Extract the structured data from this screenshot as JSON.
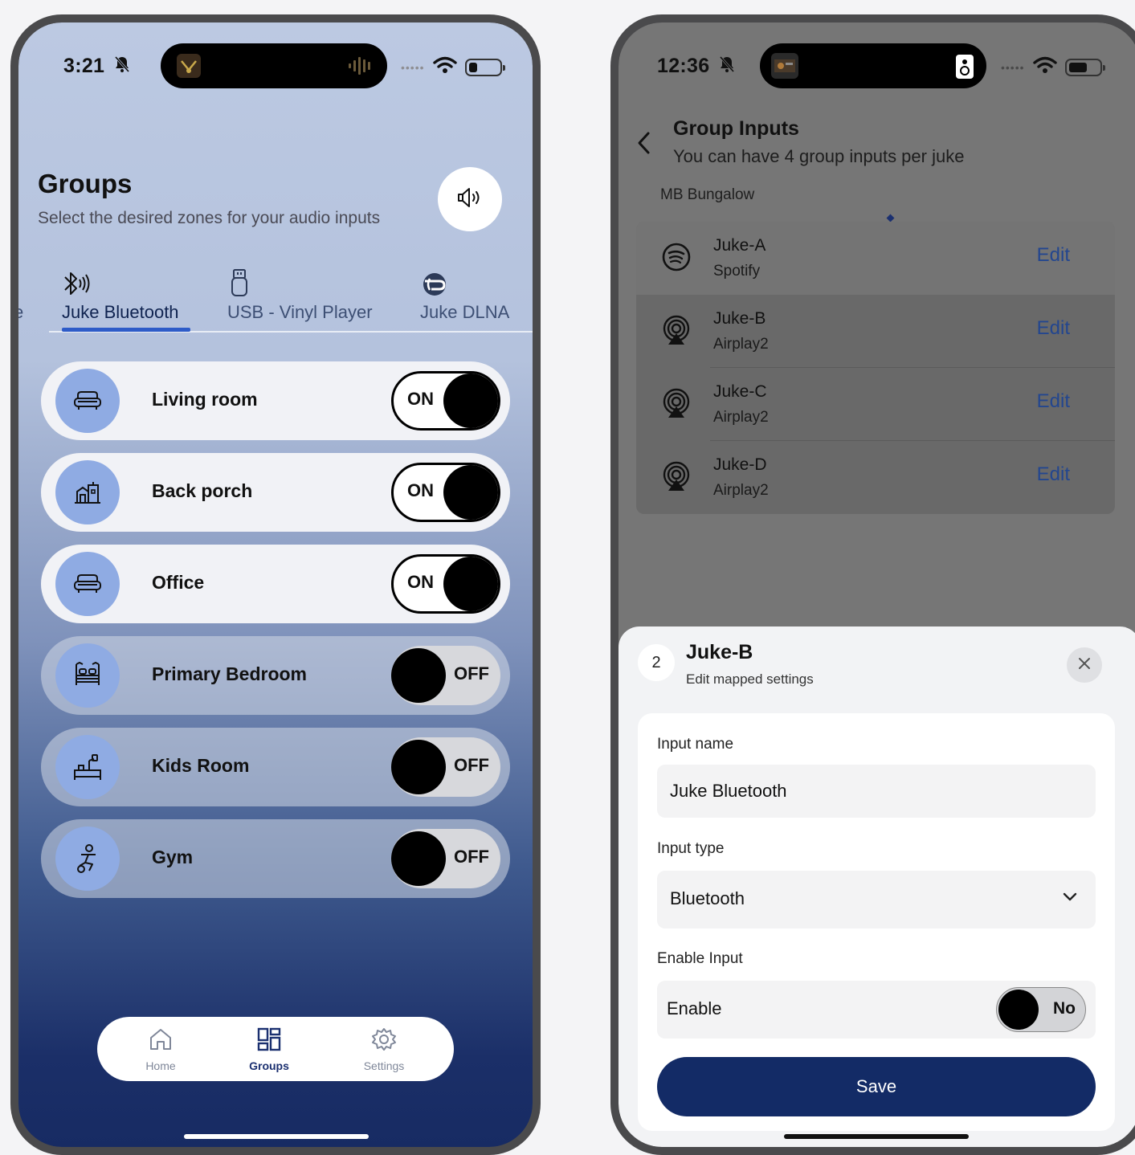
{
  "left_phone": {
    "status": {
      "time": "3:21"
    },
    "header": {
      "title": "Groups",
      "subtitle": "Select the desired zones for your audio inputs"
    },
    "tabs": [
      {
        "label": "e",
        "icon": "partial-tab"
      },
      {
        "label": "Juke Bluetooth",
        "icon": "bluetooth-audio-icon",
        "active": true
      },
      {
        "label": "USB - Vinyl Player",
        "icon": "usb-icon"
      },
      {
        "label": "Juke DLNA",
        "icon": "dlna-icon"
      }
    ],
    "zones": [
      {
        "label": "Living room",
        "icon": "sofa-icon",
        "state": "ON"
      },
      {
        "label": "Back porch",
        "icon": "house-icon",
        "state": "ON"
      },
      {
        "label": "Office",
        "icon": "sofa-icon",
        "state": "ON"
      },
      {
        "label": "Primary Bedroom",
        "icon": "bed-icon",
        "state": "OFF"
      },
      {
        "label": "Kids Room",
        "icon": "kids-desk-icon",
        "state": "OFF"
      },
      {
        "label": "Gym",
        "icon": "gym-icon",
        "state": "OFF"
      }
    ],
    "bottom_nav": [
      {
        "label": "Home",
        "icon": "home-icon"
      },
      {
        "label": "Groups",
        "icon": "groups-icon",
        "active": true
      },
      {
        "label": "Settings",
        "icon": "gear-icon"
      }
    ],
    "colors": {
      "accent": "#2d5bc8",
      "nav_active": "#1b3070",
      "zone_icon_bg": "#8fabe3"
    }
  },
  "right_phone": {
    "status": {
      "time": "12:36"
    },
    "header": {
      "title": "Group Inputs",
      "subtitle": "You can have 4 group inputs per juke"
    },
    "owner": "MB Bungalow",
    "jukes": [
      {
        "name": "Juke-A",
        "type": "Spotify",
        "icon": "spotify-icon",
        "action": "Edit"
      },
      {
        "name": "Juke-B",
        "type": "Airplay2",
        "icon": "airplay-icon",
        "action": "Edit"
      },
      {
        "name": "Juke-C",
        "type": "Airplay2",
        "icon": "airplay-icon",
        "action": "Edit"
      },
      {
        "name": "Juke-D",
        "type": "Airplay2",
        "icon": "airplay-icon",
        "action": "Edit"
      }
    ],
    "sheet": {
      "step": "2",
      "title": "Juke-B",
      "subtitle": "Edit mapped settings",
      "input_name_label": "Input name",
      "input_name_value": "Juke Bluetooth",
      "input_type_label": "Input type",
      "input_type_value": "Bluetooth",
      "enable_label": "Enable Input",
      "enable_field": "Enable",
      "enable_state": "No",
      "save_label": "Save"
    },
    "colors": {
      "save_bg": "#132b66",
      "edit_link": "#23468f"
    }
  }
}
